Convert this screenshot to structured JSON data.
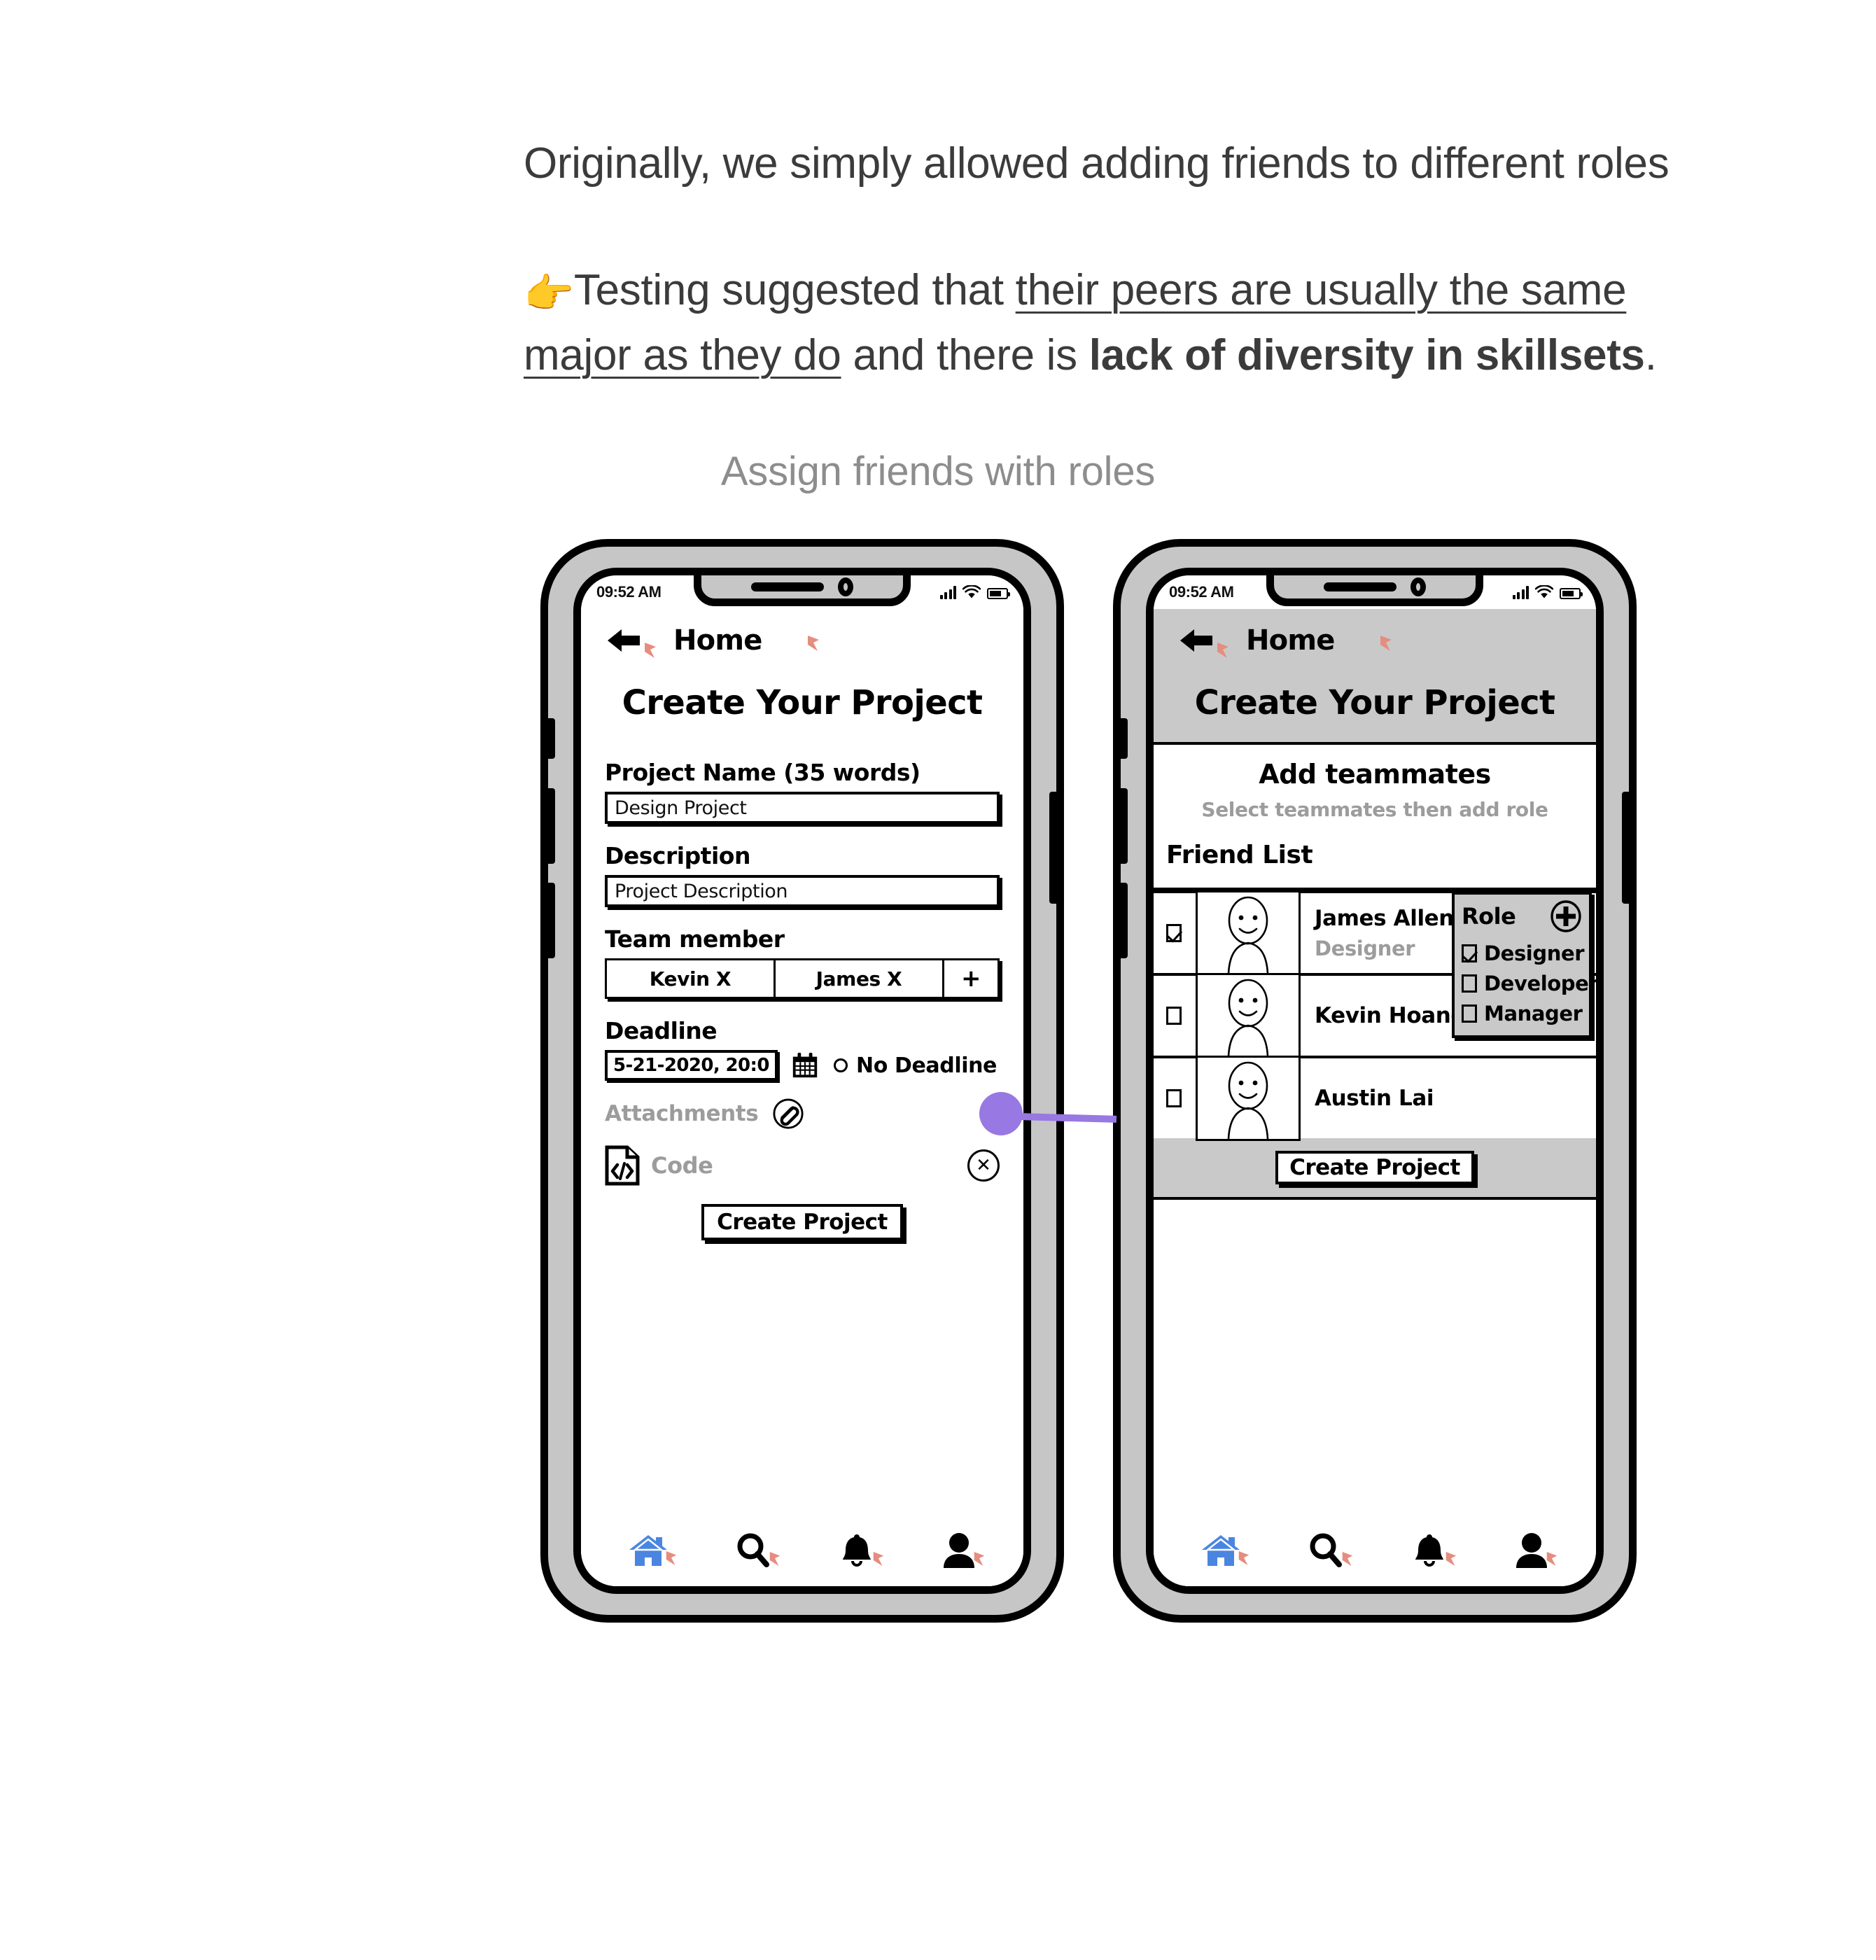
{
  "copy": {
    "line1": "Originally, we simply allowed adding friends to different roles",
    "line2_pointer": "👉",
    "line2_a": "Testing suggested that ",
    "line2_underline": "their peers are usually the same major as they do",
    "line2_b": " and there is ",
    "line2_bold": "lack of diversity in skillsets",
    "line2_end": "."
  },
  "section_caption": "Assign friends with roles",
  "phone1": {
    "status": {
      "time": "09:52 AM",
      "signal_icon": "signal-bars-icon",
      "wifi_icon": "wifi-icon",
      "battery_icon": "battery-icon"
    },
    "nav": {
      "back_icon": "back-arrow-icon",
      "title": "Home"
    },
    "page_title": "Create Your Project",
    "fields": {
      "project_name_label": "Project Name (35 words)",
      "project_name_value": "Design Project",
      "description_label": "Description",
      "description_value": "Project Description",
      "team_label": "Team member",
      "team_chips": [
        "Kevin X",
        "James X"
      ],
      "team_add": "+",
      "deadline_label": "Deadline",
      "deadline_value": "5-21-2020, 20:0",
      "calendar_icon": "calendar-icon",
      "no_deadline_label": "No Deadline",
      "attachments_label": "Attachments",
      "attachment_icon": "paperclip-blocked-icon",
      "code_file_label": "Code",
      "code_file_icon": "code-file-icon",
      "remove_icon": "x-circle-icon"
    },
    "create_button": "Create Project",
    "tabs": [
      {
        "name": "home-tab",
        "icon": "home-icon"
      },
      {
        "name": "search-tab",
        "icon": "search-icon"
      },
      {
        "name": "notifications-tab",
        "icon": "bell-icon"
      },
      {
        "name": "profile-tab",
        "icon": "person-icon"
      }
    ]
  },
  "phone2": {
    "status": {
      "time": "09:52 AM",
      "signal_icon": "signal-bars-icon",
      "wifi_icon": "wifi-icon",
      "battery_icon": "battery-icon"
    },
    "nav": {
      "back_icon": "back-arrow-icon",
      "title": "Home"
    },
    "page_title": "Create Your Project",
    "card": {
      "title": "Add teammates",
      "subtitle": "Select teammates then add role"
    },
    "friend_list_label": "Friend List",
    "friends": [
      {
        "name": "James Allen",
        "role": "Designer",
        "checked": true
      },
      {
        "name": "Kevin Hoang",
        "role": "",
        "checked": false
      },
      {
        "name": "Austin Lai",
        "role": "",
        "checked": false
      }
    ],
    "role_panel": {
      "title": "Role",
      "add_icon": "plus-circle-icon",
      "options": [
        {
          "label": "Designer",
          "checked": true
        },
        {
          "label": "Developer",
          "checked": false
        },
        {
          "label": "Manager",
          "checked": false
        }
      ]
    },
    "create_button": "Create Project",
    "tabs": [
      {
        "name": "home-tab",
        "icon": "home-icon"
      },
      {
        "name": "search-tab",
        "icon": "search-icon"
      },
      {
        "name": "notifications-tab",
        "icon": "bell-icon"
      },
      {
        "name": "profile-tab",
        "icon": "person-icon"
      }
    ]
  },
  "colors": {
    "accent_purple": "#9878e2",
    "home_blue": "#4a86e0",
    "frame_grey": "#c6c6c6",
    "muted_grey": "#9c9c9c",
    "caption_grey": "#8d8d8d"
  }
}
